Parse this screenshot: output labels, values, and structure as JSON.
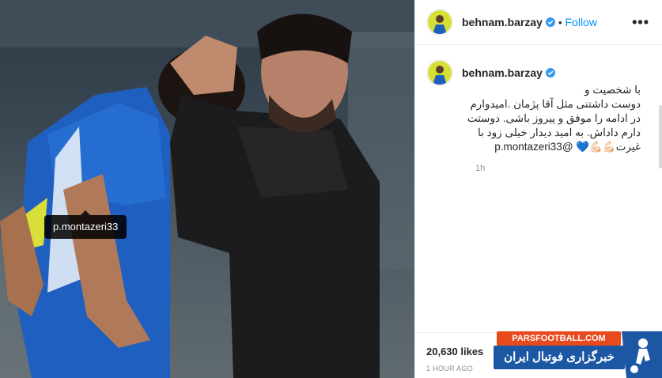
{
  "photo": {
    "tag": "p.montazeri33",
    "jersey_fragment": "#"
  },
  "post": {
    "username": "behnam.barzay",
    "follow_label": "Follow",
    "more_label": "•••",
    "caption_author": "behnam.barzay",
    "caption_lines": [
      "با شخصیت و",
      "دوست داشتنی مثل آقا پژمان .امیدوارم",
      "در ادامه را موفق و پیروز باشی. دوستت",
      "دارم داداش. به امید دیدار خیلی زود با",
      "غیرت💪🏻💪🏻💙 @p.montazeri33"
    ],
    "caption_time": "1h",
    "likes": "20,630 likes",
    "posted_ago": "1 HOUR AGO"
  },
  "watermark": {
    "site": "PARSFOOTBALL.COM",
    "tagline": "خبرگزاری فوتبال ایران"
  },
  "colors": {
    "follow_blue": "#0095f6",
    "verified_blue": "#3897f0",
    "watermark_orange": "#e8491d",
    "watermark_blue": "#1c57a3"
  },
  "icons": [
    "verified-badge-icon",
    "more-options-icon",
    "avatar-image",
    "watermark-figure-icon"
  ]
}
